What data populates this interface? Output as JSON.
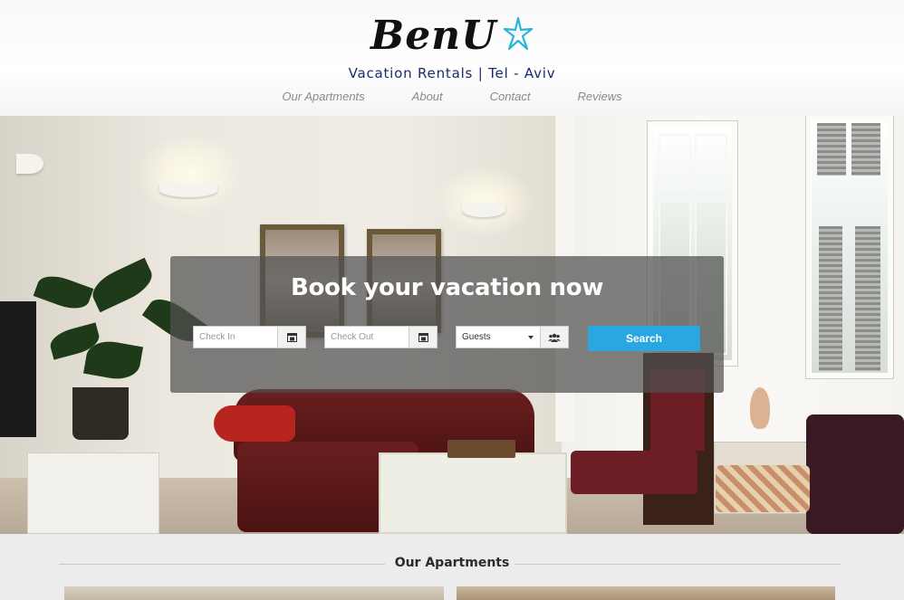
{
  "brand": {
    "name": "BenU",
    "tagline": "Vacation Rentals | Tel - Aviv",
    "star_color": "#29b6d6"
  },
  "nav": {
    "items": [
      {
        "label": "Our Apartments"
      },
      {
        "label": "About"
      },
      {
        "label": "Contact"
      },
      {
        "label": "Reviews"
      }
    ]
  },
  "booking": {
    "title": "Book your vacation now",
    "check_in_placeholder": "Check In",
    "check_out_placeholder": "Check Out",
    "guests_value": "Guests",
    "search_label": "Search",
    "accent_color": "#2aa7e1",
    "icons": [
      "calendar-icon",
      "calendar-icon",
      "users-icon"
    ]
  },
  "apartments": {
    "title": "Our Apartments"
  }
}
